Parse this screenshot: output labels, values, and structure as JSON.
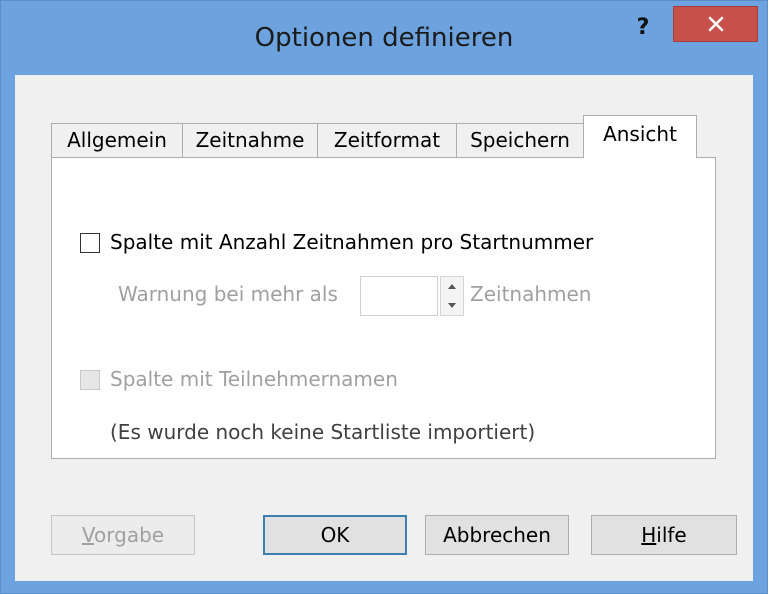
{
  "window": {
    "title": "Optionen definieren",
    "help_label": "?",
    "accent": "#6ca3de",
    "close_color": "#c7504a"
  },
  "tabs": [
    {
      "label": "Allgemein",
      "active": false
    },
    {
      "label": "Zeitnahme",
      "active": false
    },
    {
      "label": "Zeitformat",
      "active": false
    },
    {
      "label": "Speichern",
      "active": false
    },
    {
      "label": "Ansicht",
      "active": true
    }
  ],
  "ansicht": {
    "count_column_label": "Spalte mit Anzahl Zeitnahmen pro Startnummer",
    "count_column_checked": false,
    "warning_prefix": "Warnung bei mehr als",
    "warning_value": "",
    "warning_suffix": "Zeitnahmen",
    "names_column_label": "Spalte mit Teilnehmernamen",
    "names_column_checked": false,
    "names_column_disabled": true,
    "names_note": "(Es wurde noch keine Startliste importiert)"
  },
  "buttons": {
    "default_first": "V",
    "default_rest": "orgabe",
    "ok": "OK",
    "cancel": "Abbrechen",
    "help_first": "H",
    "help_rest": "ilfe"
  }
}
